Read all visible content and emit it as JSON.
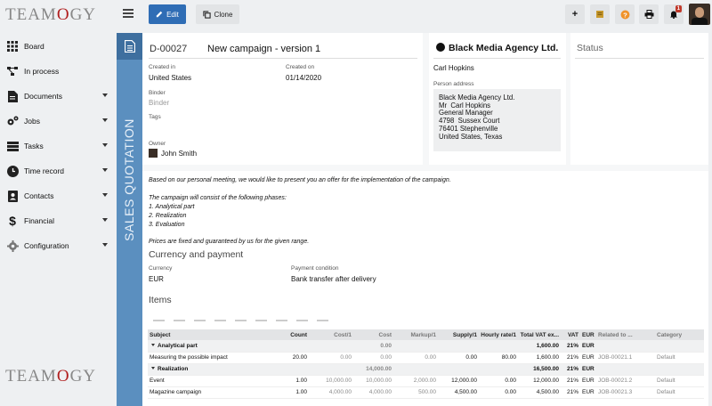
{
  "app": {
    "logo_text_1": "TEAM",
    "logo_text_o": "O",
    "logo_text_2": "GY"
  },
  "toolbar": {
    "edit_label": "Edit",
    "clone_label": "Clone",
    "notifications_count": "1"
  },
  "sidebar": {
    "items": [
      {
        "label": "Board",
        "icon": "grid-icon",
        "dropdown": false
      },
      {
        "label": "In process",
        "icon": "flow-icon",
        "dropdown": false
      },
      {
        "label": "Documents",
        "icon": "document-icon",
        "dropdown": true
      },
      {
        "label": "Jobs",
        "icon": "gears-icon",
        "dropdown": true
      },
      {
        "label": "Tasks",
        "icon": "tasks-icon",
        "dropdown": true
      },
      {
        "label": "Time record",
        "icon": "clock-icon",
        "dropdown": true
      },
      {
        "label": "Contacts",
        "icon": "contact-card-icon",
        "dropdown": true
      },
      {
        "label": "Financial",
        "icon": "dollar-icon",
        "dropdown": true
      },
      {
        "label": "Configuration",
        "icon": "gear-icon",
        "dropdown": true
      }
    ]
  },
  "document": {
    "vertical_label": "SALES QUOTATION",
    "number": "D-00027",
    "title": "New campaign - version 1",
    "created_in_label": "Created in",
    "created_in": "United States",
    "created_on_label": "Created on",
    "created_on": "01/14/2020",
    "binder_label": "Binder",
    "binder_placeholder": "Binder",
    "tags_label": "Tags",
    "owner_label": "Owner",
    "owner": "John Smith"
  },
  "customer": {
    "name": "Black Media Agency Ltd.",
    "contact": "Carl Hopkins",
    "address_label": "Person address",
    "address_lines": [
      "Black Media Agency Ltd.",
      "Mr  Carl Hopkins",
      "General Manager",
      "4798  Sussex Court",
      "76401 Stephenville",
      "United States, Texas"
    ]
  },
  "status": {
    "title": "Status"
  },
  "body": {
    "intro": "Based on our personal meeting, we would like to present you an offer for the implementation of the campaign.",
    "phases_intro": "The campaign will consist of the following phases:",
    "phase_1": "1. Analytical part",
    "phase_2": "2. Realization",
    "phase_3": "3. Evaluation",
    "prices_note": "Prices are fixed and guaranteed by us for the given range.",
    "currency_section": "Currency and payment",
    "currency_label": "Currency",
    "currency": "EUR",
    "payment_label": "Payment condition",
    "payment": "Bank transfer after delivery",
    "items_section": "Items"
  },
  "items_table": {
    "headers": [
      "Subject",
      "Count",
      "Cost/1",
      "Cost",
      "Markup/1",
      "Supply/1",
      "Hourly rate/1",
      "Total VAT ex...",
      "VAT",
      "EUR",
      "Related to ...",
      "Category"
    ],
    "rows": [
      {
        "type": "group",
        "cells": [
          "Analytical part",
          "",
          "",
          "0.00",
          "",
          "",
          "",
          "1,600.00",
          "21%",
          "EUR",
          "",
          ""
        ]
      },
      {
        "type": "item",
        "cells": [
          "Measuring the possible impact",
          "20.00",
          "0.00",
          "0.00",
          "0.00",
          "0.00",
          "80.00",
          "1,600.00",
          "21%",
          "EUR",
          "JOB-00021.1",
          "Default"
        ]
      },
      {
        "type": "group",
        "cells": [
          "Realization",
          "",
          "",
          "14,000.00",
          "",
          "",
          "",
          "16,500.00",
          "21%",
          "EUR",
          "",
          ""
        ]
      },
      {
        "type": "item",
        "cells": [
          "Event",
          "1.00",
          "10,000.00",
          "10,000.00",
          "2,000.00",
          "12,000.00",
          "0.00",
          "12,000.00",
          "21%",
          "EUR",
          "JOB-00021.2",
          "Default"
        ]
      },
      {
        "type": "item",
        "cells": [
          "Magazine campaign",
          "1.00",
          "4,000.00",
          "4,000.00",
          "500.00",
          "4,500.00",
          "0.00",
          "4,500.00",
          "21%",
          "EUR",
          "JOB-00021.3",
          "Default"
        ]
      }
    ]
  }
}
